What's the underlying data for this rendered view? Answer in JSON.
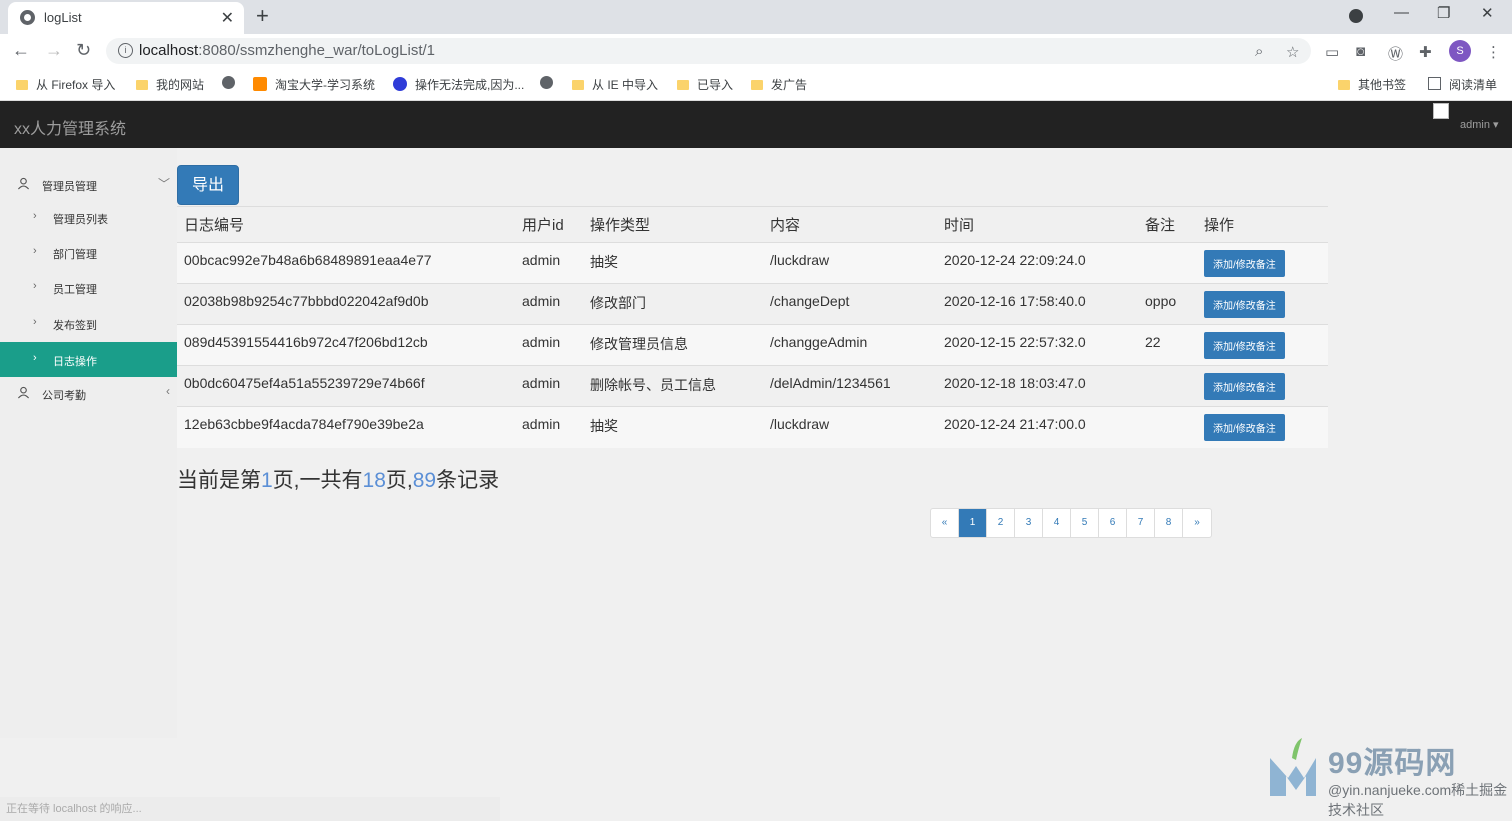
{
  "browser": {
    "tab_title": "logList",
    "url_host": "localhost",
    "url_rest": ":8080/ssmzhenghe_war/toLogList/1",
    "avatar_letter": "S",
    "bookmarks": [
      "从 Firefox 导入",
      "我的网站",
      "淘宝大学-学习系统",
      "操作无法完成,因为...",
      "从 IE 中导入",
      "已导入",
      "发广告",
      "其他书签",
      "阅读清单"
    ]
  },
  "app": {
    "brand": "xx人力管理系统",
    "user": "admin",
    "sidebar": {
      "group1": "管理员管理",
      "items": [
        "管理员列表",
        "部门管理",
        "员工管理",
        "发布签到",
        "日志操作"
      ],
      "active_item": "日志操作",
      "group2": "公司考勤"
    },
    "export_label": "导出",
    "table": {
      "headers": [
        "日志编号",
        "用户id",
        "操作类型",
        "内容",
        "时间",
        "备注",
        "操作"
      ],
      "action_label": "添加/修改备注",
      "rows": [
        [
          "00bcac992e7b48a6b68489891eaa4e77",
          "admin",
          "抽奖",
          "/luckdraw",
          "2020-12-24 22:09:24.0",
          ""
        ],
        [
          "02038b98b9254c77bbbd022042af9d0b",
          "admin",
          "修改部门",
          "/changeDept",
          "2020-12-16 17:58:40.0",
          "oppo"
        ],
        [
          "089d45391554416b972c47f206bd12cb",
          "admin",
          "修改管理员信息",
          "/changgeAdmin",
          "2020-12-15 22:57:32.0",
          "22"
        ],
        [
          "0b0dc60475ef4a51a55239729e74b66f",
          "admin",
          "删除帐号、员工信息",
          "/delAdmin/1234561",
          "2020-12-18 18:03:47.0",
          ""
        ],
        [
          "12eb63cbbe9f4acda784ef790e39be2a",
          "admin",
          "抽奖",
          "/luckdraw",
          "2020-12-24 21:47:00.0",
          ""
        ]
      ]
    },
    "page_info": {
      "prefix": "当前是第",
      "current": "1",
      "mid1": "页,一共有",
      "total_pages": "18",
      "mid2": "页,",
      "total_records": "89",
      "suffix": "条记录"
    },
    "pager": [
      "«",
      "1",
      "2",
      "3",
      "4",
      "5",
      "6",
      "7",
      "8",
      "»"
    ],
    "pager_current": "1"
  },
  "status_bar": "正在等待 localhost 的响应...",
  "watermark": {
    "title": "99源码网",
    "subtitle": "@yin.nanjueke.com稀土掘金技术社区"
  },
  "colors": {
    "primary": "#337ab7",
    "sidebar_active": "#1a9e8a",
    "navbar": "#222222"
  }
}
